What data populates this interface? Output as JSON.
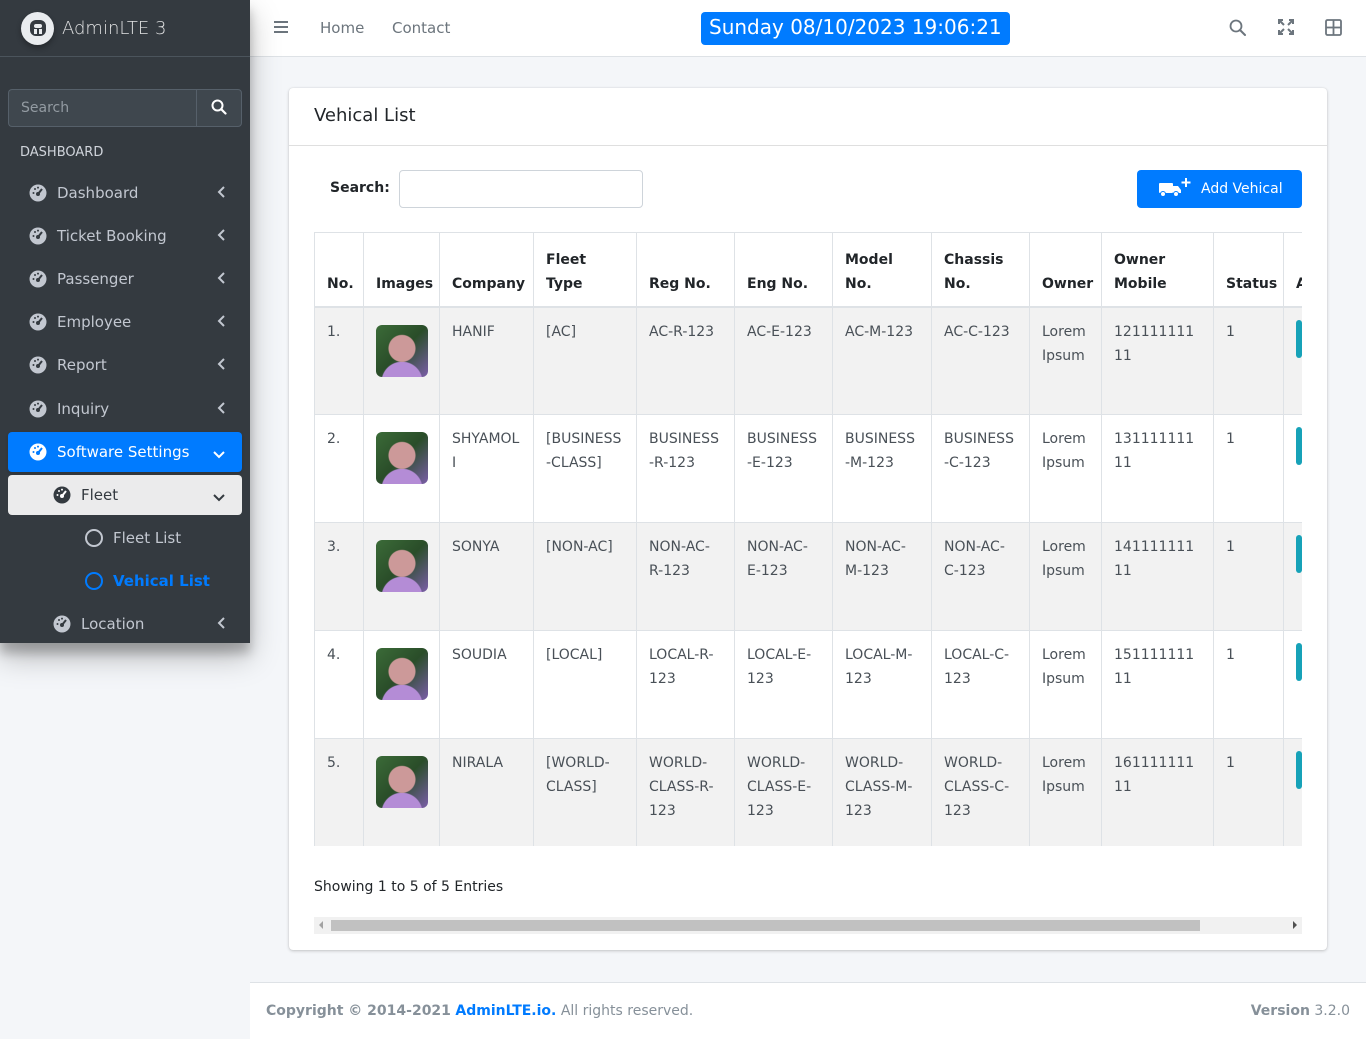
{
  "brand": {
    "name": "AdminLTE 3"
  },
  "sidebar": {
    "search_placeholder": "Search",
    "header": "DASHBOARD",
    "items": [
      {
        "label": "Dashboard"
      },
      {
        "label": "Ticket Booking"
      },
      {
        "label": "Passenger"
      },
      {
        "label": "Employee"
      },
      {
        "label": "Report"
      },
      {
        "label": "Inquiry"
      },
      {
        "label": "Software Settings"
      },
      {
        "label": "Fleet"
      },
      {
        "label": "Fleet List"
      },
      {
        "label": "Vehical List"
      },
      {
        "label": "Location"
      }
    ]
  },
  "topbar": {
    "links": [
      "Home",
      "Contact"
    ],
    "datetime": "Sunday 08/10/2023 19:06:21"
  },
  "card": {
    "title": "Vehical List",
    "search_label": "Search:",
    "add_button": "Add Vehical",
    "showing": "Showing 1 to 5 of 5 Entries"
  },
  "table": {
    "headers": [
      "No.",
      "Images",
      "Company",
      "Fleet Type",
      "Reg No.",
      "Eng No.",
      "Model No.",
      "Chassis No.",
      "Owner",
      "Owner Mobile",
      "Status",
      "Action"
    ],
    "rows": [
      {
        "no": "1.",
        "company": "HANIF",
        "fleet": "[AC]",
        "reg": "AC-R-123",
        "eng": "AC-E-123",
        "model": "AC-M-123",
        "chassis": "AC-C-123",
        "owner": "Lorem Ipsum",
        "mobile": "12111111111",
        "status": "1"
      },
      {
        "no": "2.",
        "company": "SHYAMOLI",
        "fleet": "[BUSINESS-CLASS]",
        "reg": "BUSINESS-R-123",
        "eng": "BUSINESS-E-123",
        "model": "BUSINESS-M-123",
        "chassis": "BUSINESS-C-123",
        "owner": "Lorem Ipsum",
        "mobile": "13111111111",
        "status": "1"
      },
      {
        "no": "3.",
        "company": "SONYA",
        "fleet": "[NON-AC]",
        "reg": "NON-AC-R-123",
        "eng": "NON-AC-E-123",
        "model": "NON-AC-M-123",
        "chassis": "NON-AC-C-123",
        "owner": "Lorem Ipsum",
        "mobile": "14111111111",
        "status": "1"
      },
      {
        "no": "4.",
        "company": "SOUDIA",
        "fleet": "[LOCAL]",
        "reg": "LOCAL-R-123",
        "eng": "LOCAL-E-123",
        "model": "LOCAL-M-123",
        "chassis": "LOCAL-C-123",
        "owner": "Lorem Ipsum",
        "mobile": "15111111111",
        "status": "1"
      },
      {
        "no": "5.",
        "company": "NIRALA",
        "fleet": "[WORLD-CLASS]",
        "reg": "WORLD-CLASS-R-123",
        "eng": "WORLD-CLASS-E-123",
        "model": "WORLD-CLASS-M-123",
        "chassis": "WORLD-CLASS-C-123",
        "owner": "Lorem Ipsum",
        "mobile": "16111111111",
        "status": "1"
      }
    ]
  },
  "footer": {
    "copyright": "Copyright © 2014-2021",
    "link": "AdminLTE.io.",
    "rights": "All rights reserved.",
    "version_label": "Version",
    "version": "3.2.0"
  },
  "colors": {
    "primary": "#007bff",
    "sidebar": "#343a40",
    "info": "#17a2b8"
  },
  "icons": [
    "search-icon",
    "tachometer-icon",
    "circle-icon",
    "chevron-left-icon",
    "chevron-down-icon",
    "bars-icon",
    "expand-icon",
    "th-icon",
    "truck-plus-icon"
  ]
}
